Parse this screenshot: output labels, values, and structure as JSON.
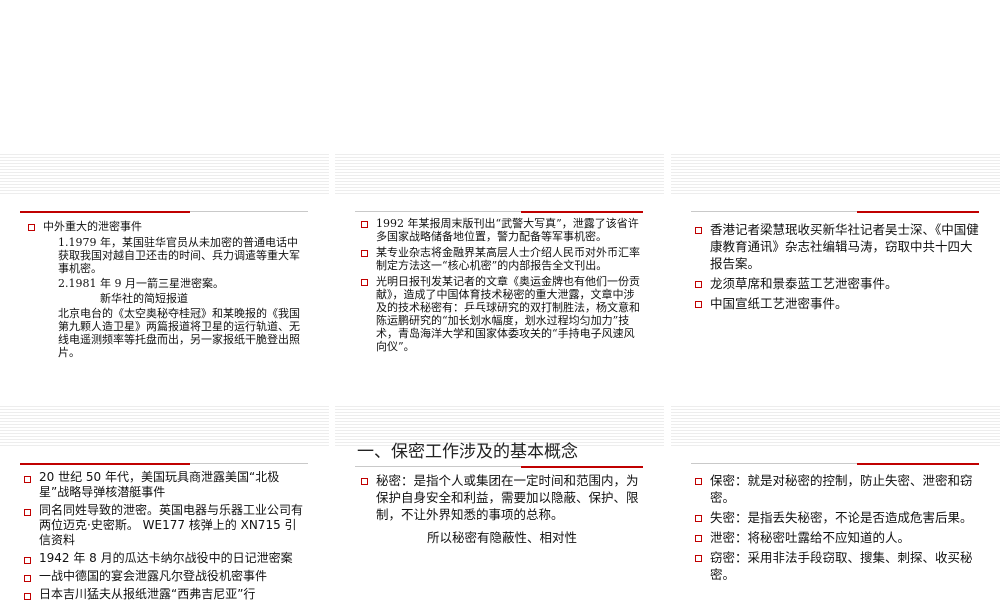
{
  "slide1": {
    "items": [
      {
        "bullet": true,
        "text": "中外重大的泄密事件"
      },
      {
        "bullet": false,
        "style": "indent",
        "text": "1.1979 年，某国驻华官员从未加密的普通电话中获取我国对越自卫还击的时间、兵力调遣等重大军事机密。"
      },
      {
        "bullet": false,
        "style": "indent",
        "text": "2.1981 年 9 月一箭三星泄密案。"
      },
      {
        "bullet": false,
        "style": "indent2",
        "text": "新华社的简短报道"
      },
      {
        "bullet": false,
        "style": "indent",
        "text": "北京电台的《太空奥秘夺桂冠》和某晚报的《我国第九颗人造卫星》两篇报道将卫星的运行轨道、无线电遥测频率等托盘而出，另一家报纸干脆登出照片。"
      }
    ]
  },
  "slide2": {
    "items": [
      {
        "bullet": true,
        "text": "1992 年某报周末版刊出“武警大写真”，泄露了该省许多国家战略储备地位置，警力配备等军事机密。"
      },
      {
        "bullet": true,
        "text": "某专业杂志将金融界某高层人士介绍人民币对外币汇率制定方法这一“核心机密”的内部报告全文刊出。"
      },
      {
        "bullet": true,
        "text": "光明日报刊发某记者的文章《奥运金牌也有他们一份贡献》，造成了中国体育技术秘密的重大泄露，文章中涉及的技术秘密有：乒乓球研究的双打制胜法，杨文意和陈运鹏研究的“加长划水幅度，划水过程均匀加力”技术，青岛海洋大学和国家体委攻关的“手持电子风速风向仪”。"
      }
    ]
  },
  "slide3": {
    "items": [
      {
        "bullet": true,
        "text": "香港记者梁慧珉收买新华社记者吴士深、《中国健康教育通讯》杂志社编辑马涛，窃取中共十四大报告案。"
      },
      {
        "bullet": true,
        "text": "龙须草席和景泰蓝工艺泄密事件。"
      },
      {
        "bullet": true,
        "text": "中国宣纸工艺泄密事件。"
      }
    ]
  },
  "slide4": {
    "items": [
      {
        "bullet": true,
        "text": "20 世纪 50 年代，美国玩具商泄露美国“北极星”战略导弹核潜艇事件"
      },
      {
        "bullet": true,
        "text": "同名同姓导致的泄密。英国电器与乐器工业公司有两位迈克·史密斯。 WE177 核弹上的 XN715 引信资料"
      },
      {
        "bullet": true,
        "text": "1942 年 8 月的瓜达卡纳尔战役中的日记泄密案"
      },
      {
        "bullet": true,
        "text": "一战中德国的宴会泄露凡尔登战役机密事件"
      },
      {
        "bullet": true,
        "text": "日本吉川猛夫从报纸泄露“西弗吉尼亚”行"
      }
    ]
  },
  "slide5": {
    "title": "一、保密工作涉及的基本概念",
    "items": [
      {
        "bullet": true,
        "text": "秘密：是指个人或集团在一定时间和范围内，为保护自身安全和利益，需要加以隐蔽、保护、限制，不让外界知悉的事项的总称。"
      }
    ],
    "note": "所以秘密有隐蔽性、相对性"
  },
  "slide6": {
    "items": [
      {
        "bullet": true,
        "text": "保密：就是对秘密的控制，防止失密、泄密和窃密。"
      },
      {
        "bullet": true,
        "text": "失密：是指丢失秘密，不论是否造成危害后果。"
      },
      {
        "bullet": true,
        "text": "泄密：将秘密吐露给不应知道的人。"
      },
      {
        "bullet": true,
        "text": "窃密：采用非法手段窃取、搜集、刺探、收买秘密。"
      }
    ]
  }
}
